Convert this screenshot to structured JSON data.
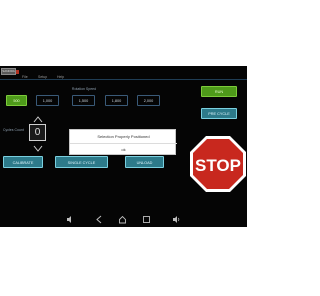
{
  "app": {
    "logo_text": "SANDRA",
    "menu": [
      "File",
      "Setup",
      "Help"
    ]
  },
  "speed": {
    "title": "Rotation Speed",
    "options": [
      "500",
      "1,000",
      "1,500",
      "1,800",
      "2,000"
    ],
    "selected": "500"
  },
  "actions": {
    "run": "RUN",
    "pre_cycle": "PRE CYCLE",
    "calibrate": "CALIBRATE",
    "single_cycle": "SINGLE CYCLE",
    "unload": "UNLOAD"
  },
  "cycles": {
    "label": "Cycles Count",
    "value": "0"
  },
  "stop_sign": {
    "text": "STOP"
  },
  "dialog": {
    "message": "Selection Properly Positioned",
    "ok": "ok"
  },
  "icons": {
    "arrow_up": "chevron-up-icon",
    "arrow_down": "chevron-down-icon",
    "nav": [
      "volume-down-icon",
      "back-icon",
      "home-icon",
      "recents-icon",
      "volume-up-icon"
    ]
  },
  "colors": {
    "active_green": "#4e9a1a",
    "teal": "#2d7a8a",
    "stop_red": "#c8281e"
  }
}
